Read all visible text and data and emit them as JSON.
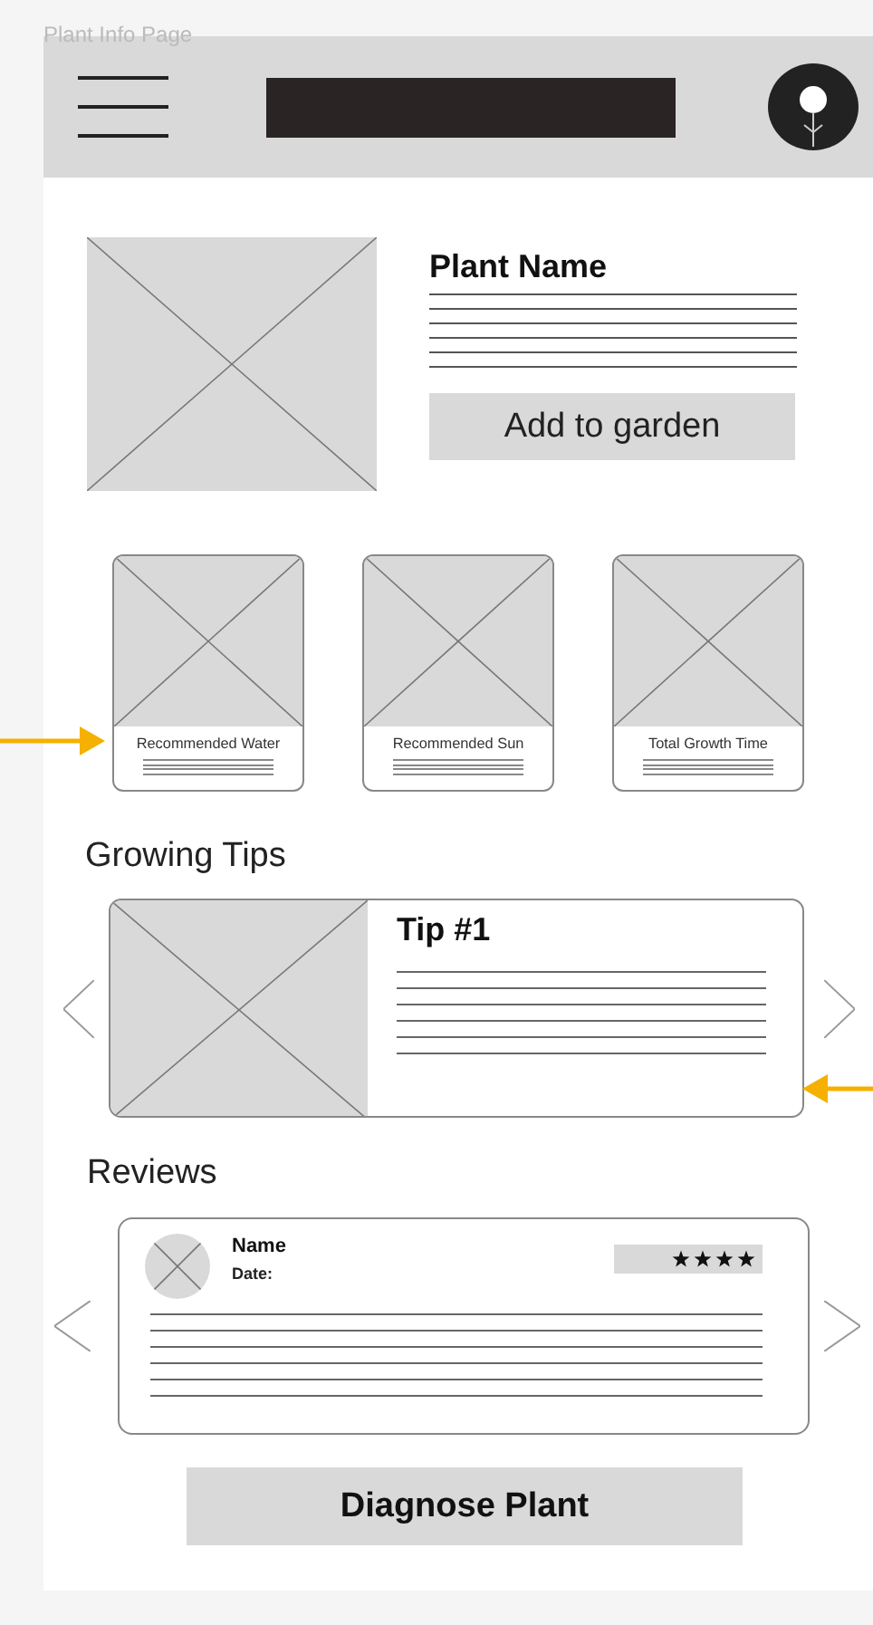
{
  "frame_label": "Plant Info Page",
  "plant": {
    "name": "Plant Name",
    "button": "Add to garden"
  },
  "stats": [
    {
      "label": "Recommended Water"
    },
    {
      "label": "Recommended Sun"
    },
    {
      "label": "Total Growth Time"
    }
  ],
  "growing_tips": {
    "heading": "Growing Tips",
    "tips": [
      {
        "title": "Tip #1"
      }
    ]
  },
  "reviews": {
    "heading": "Reviews",
    "items": [
      {
        "name": "Name",
        "date": "Date:",
        "stars": 4
      }
    ]
  },
  "diagnose_button": "Diagnose Plant"
}
